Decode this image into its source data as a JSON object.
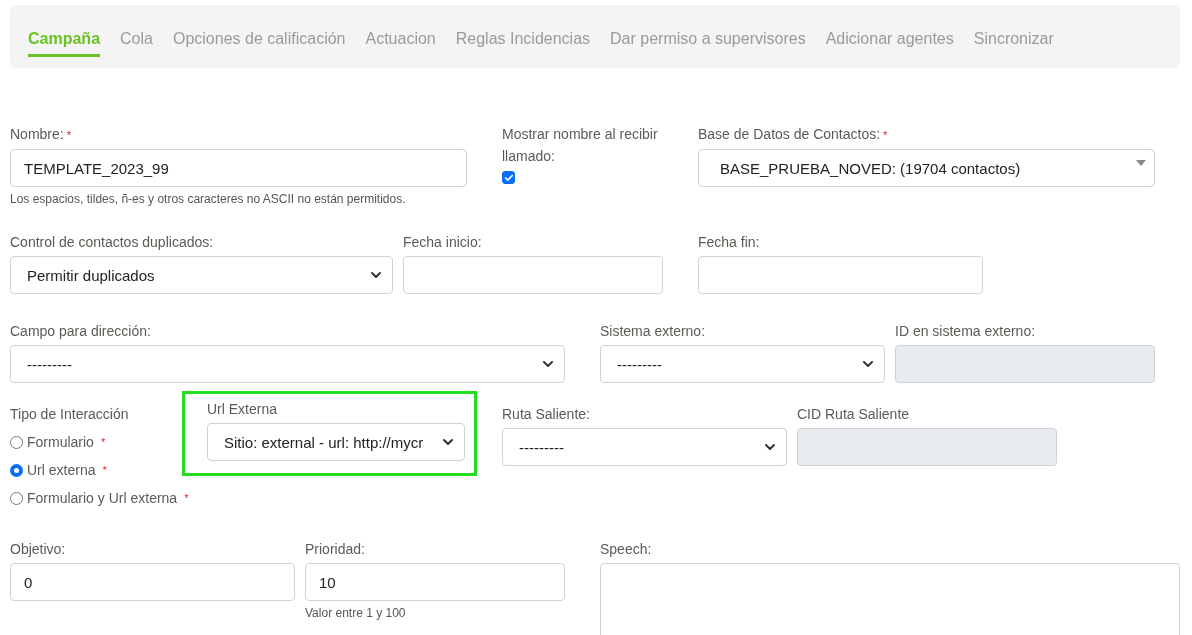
{
  "tabs": [
    {
      "label": "Campaña",
      "selected": true
    },
    {
      "label": "Cola",
      "selected": false
    },
    {
      "label": "Opciones de calificación",
      "selected": false
    },
    {
      "label": "Actuacion",
      "selected": false
    },
    {
      "label": "Reglas Incidencias",
      "selected": false
    },
    {
      "label": "Dar permiso a supervisores",
      "selected": false
    },
    {
      "label": "Adicionar agentes",
      "selected": false
    },
    {
      "label": "Sincronizar",
      "selected": false
    }
  ],
  "rows": [
    {
      "fields": [
        {
          "kind": "text",
          "label": "Nombre:",
          "mark": "*",
          "value": "TEMPLATE_2023_99",
          "help": "Los espacios, tildes, ñ-es y otros caracteres no ASCII no están permitidos."
        },
        {
          "kind": "checkbox",
          "label": "Mostrar nombre al recibir llamado:",
          "checked": true
        },
        {
          "kind": "select2",
          "label": "Base de Datos de Contactos:",
          "mark": "*",
          "value": "BASE_PRUEBA_NOVED: (19704 contactos)"
        }
      ]
    },
    {
      "fields": [
        {
          "kind": "select",
          "label": "Control de contactos duplicados:",
          "value": "Permitir duplicados"
        },
        {
          "kind": "text",
          "label": "Fecha inicio:"
        },
        {
          "kind": "text",
          "label": "Fecha fin:"
        }
      ]
    },
    {
      "fields": [
        {
          "kind": "select",
          "label": "Campo para dirección:",
          "value": "---------"
        },
        {
          "kind": "select",
          "label": "Sistema externo:",
          "value": "---------"
        },
        {
          "kind": "disabled",
          "label": "ID en sistema externo:"
        }
      ]
    },
    {
      "fields": [
        {
          "kind": "radio",
          "label": "Tipo de Interacción",
          "options": [
            {
              "label": "Formulario",
              "mark": "*",
              "selected": false
            },
            {
              "label": "Url externa",
              "mark": "*",
              "selected": true
            },
            {
              "label": "Formulario y Url externa",
              "mark": "*",
              "selected": false
            }
          ]
        },
        {
          "kind": "select",
          "label": "Url Externa",
          "value": "Sitio: external - url: http://mycr",
          "highlighted": true
        },
        {
          "kind": "select",
          "label": "Ruta Saliente:",
          "value": "---------"
        },
        {
          "kind": "disabled",
          "label": "CID Ruta Saliente"
        }
      ]
    },
    {
      "fields": [
        {
          "kind": "text",
          "label": "Objetivo:",
          "value": "0"
        },
        {
          "kind": "text",
          "label": "Prioridad:",
          "value": "10",
          "help": "Valor entre 1 y 100"
        },
        {
          "kind": "textarea",
          "label": "Speech:"
        }
      ]
    }
  ]
}
